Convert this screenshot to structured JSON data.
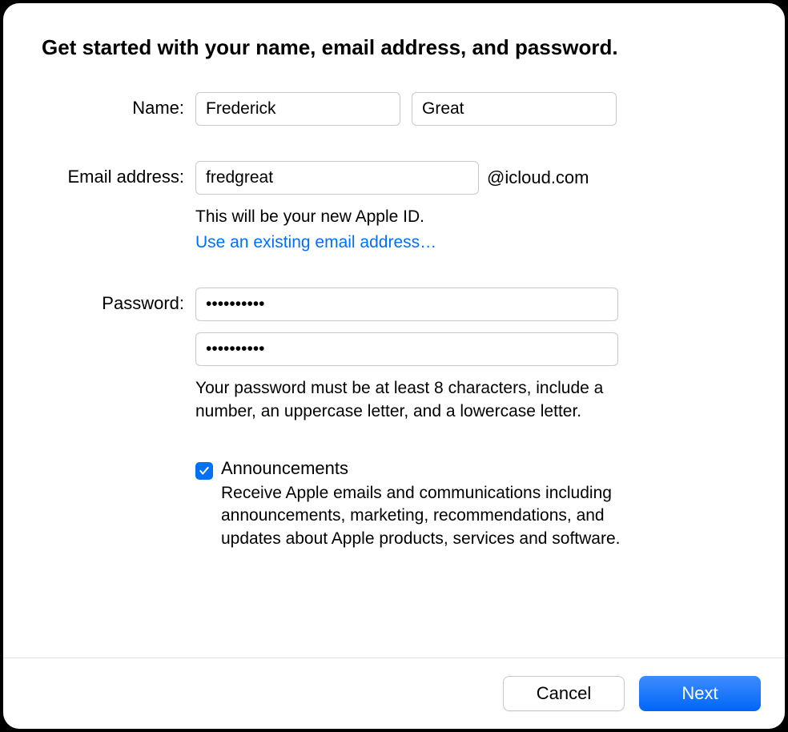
{
  "heading": "Get started with your name, email address, and password.",
  "form": {
    "name_label": "Name:",
    "first_name_value": "Frederick",
    "last_name_value": "Great",
    "email_label": "Email address:",
    "email_value": "fredgreat",
    "email_suffix": "@icloud.com",
    "email_helper": "This will be your new Apple ID.",
    "email_link": "Use an existing email address…",
    "password_label": "Password:",
    "password_value": "••••••••••",
    "password_confirm_value": "••••••••••",
    "password_helper": "Your password must be at least 8 characters, include a number, an uppercase letter, and a lowercase letter.",
    "announcements": {
      "checked": true,
      "title": "Announcements",
      "description": "Receive Apple emails and communications including announcements, marketing, recommendations, and updates about Apple products, services and software."
    }
  },
  "buttons": {
    "cancel": "Cancel",
    "next": "Next"
  }
}
